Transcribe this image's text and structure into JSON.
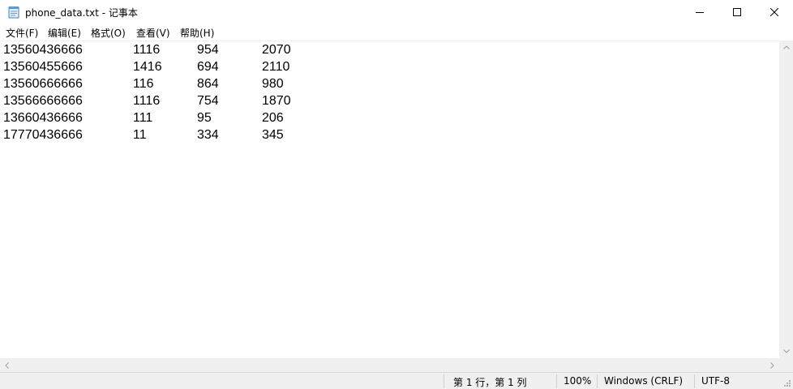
{
  "window": {
    "title": "phone_data.txt - 记事本"
  },
  "menu": {
    "items": [
      "文件(F)",
      "编辑(E)",
      "格式(O)",
      "查看(V)",
      "帮助(H)"
    ]
  },
  "editor": {
    "rows": [
      [
        "13560436666",
        "1116",
        "954",
        "2070"
      ],
      [
        "13560455666",
        "1416",
        "694",
        "2110"
      ],
      [
        "13560666666",
        "116",
        "864",
        "980"
      ],
      [
        "13566666666",
        "1116",
        "754",
        "1870"
      ],
      [
        "13660436666",
        "111",
        "95",
        "206"
      ],
      [
        "17770436666",
        "11",
        "334",
        "345"
      ]
    ]
  },
  "status": {
    "position": "第 1 行，第 1 列",
    "zoom": "100%",
    "line_ending": "Windows (CRLF)",
    "encoding": "UTF-8"
  },
  "icons": {
    "app": "notepad-icon",
    "minimize": "minimize-icon",
    "maximize": "maximize-icon",
    "close": "close-icon"
  }
}
